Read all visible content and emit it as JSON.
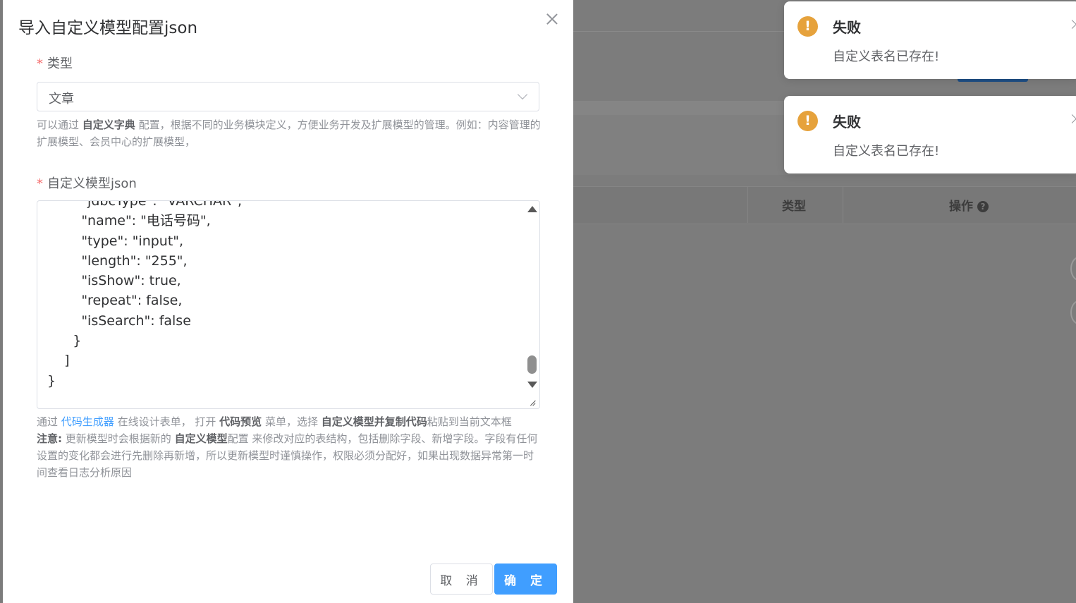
{
  "background": {
    "table_headers": [
      "类型",
      "操作"
    ],
    "help_icon": "question-circle-icon"
  },
  "dialog": {
    "title": "导入自定义模型配置json",
    "close_icon": "close-icon",
    "type_field": {
      "required_mark": "*",
      "label": "类型",
      "value": "文章",
      "hint_prefix": "可以通过",
      "hint_bold": "自定义字典",
      "hint_suffix": "配置，根据不同的业务模块定义，方便业务开发及扩展模型的管理。例如：内容管理的扩展模型、会员中心的扩展模型，"
    },
    "json_field": {
      "required_mark": "*",
      "label": "自定义模型json",
      "content": "        \"jdbcType\": \"VARCHAR\",\n        \"name\": \"电话号码\",\n        \"type\": \"input\",\n        \"length\": \"255\",\n        \"isShow\": true,\n        \"repeat\": false,\n        \"isSearch\": false\n      }\n    ]\n}",
      "hint": {
        "t1": "通过",
        "link": "代码生成器",
        "t2": "在线设计表单，  打开",
        "b1": "代码预览",
        "t3": "菜单，选择",
        "b2": "自定义模型",
        "t4": "并",
        "b3": "复制代码",
        "t5": "粘贴到当前文本框",
        "note_label": "注意:",
        "n1": "更新模型时会根据新的",
        "nb": "自定义模型",
        "n2": "配置 来修改对应的表结构，包括删除字段、新增字段。字段有任何设置的变化都会进行先删除再新增，所以更新模型时谨慎操作，权限必须分配好，如果出现数据异常第一时间查看日志分析原因"
      }
    },
    "buttons": {
      "cancel": "取 消",
      "confirm": "确 定"
    }
  },
  "notifications": [
    {
      "title": "失败",
      "message": "自定义表名已存在!",
      "icon": "warning-icon",
      "icon_color": "#e6a23c"
    },
    {
      "title": "失败",
      "message": "自定义表名已存在!",
      "icon": "warning-icon",
      "icon_color": "#e6a23c"
    }
  ],
  "colors": {
    "primary": "#409eff",
    "danger": "#f56c6c",
    "warning": "#e6a23c"
  }
}
